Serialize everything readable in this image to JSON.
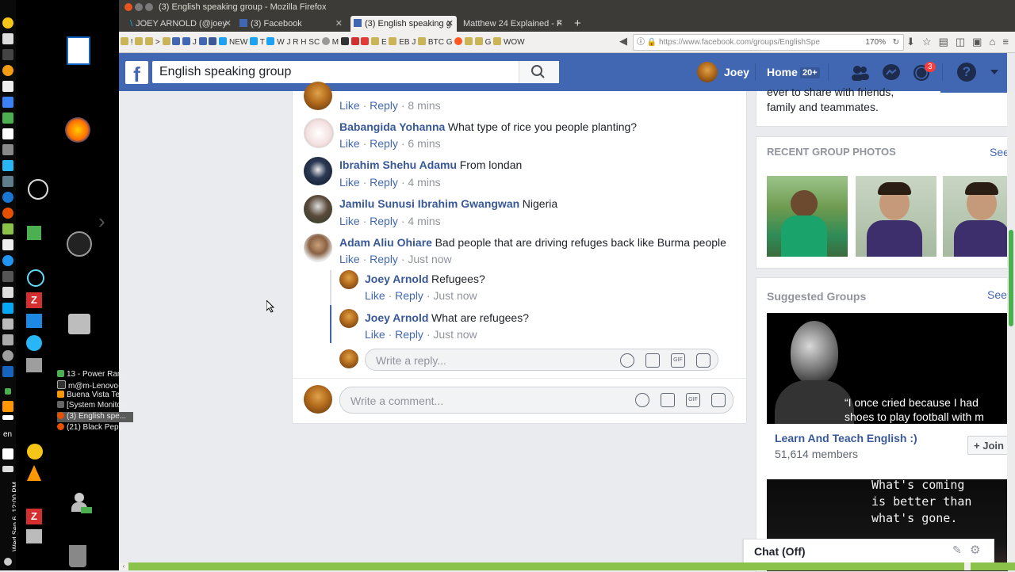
{
  "window": {
    "title": "(3) English speaking group - Mozilla Firefox"
  },
  "tabs": [
    {
      "label": "JOEY ARNOLD (@joey",
      "icon": "twitter-icon"
    },
    {
      "label": "(3) Facebook",
      "icon": "facebook-icon"
    },
    {
      "label": "(3) English speaking g",
      "icon": "facebook-icon",
      "active": true
    },
    {
      "label": "Matthew 24 Explained - F",
      "icon": ""
    }
  ],
  "bookmarks": [
    "!",
    ">",
    "J",
    "NEW",
    "T",
    "W",
    "J",
    "R",
    "H",
    "SC",
    "M",
    "E",
    "EB",
    "J",
    "BTC",
    "G",
    "G",
    "WOW"
  ],
  "address": {
    "url": "https://www.facebook.com/groups/EnglishSpe",
    "zoom": "170%"
  },
  "header": {
    "search_value": "English speaking group",
    "user_name": "Joey",
    "home_label": "Home",
    "home_badge": "20+",
    "notif_badge": "3",
    "brand_color": "#4267b2"
  },
  "comments": [
    {
      "name": "",
      "text": "",
      "like": "Like",
      "reply": "Reply",
      "time": "8 mins"
    },
    {
      "name": "Babangida Yohanna",
      "text": "What type of rice you people planting?",
      "like": "Like",
      "reply": "Reply",
      "time": "6 mins"
    },
    {
      "name": "Ibrahim Shehu Adamu",
      "text": "From londan",
      "like": "Like",
      "reply": "Reply",
      "time": "4 mins"
    },
    {
      "name": "Jamilu Sunusi Ibrahim Gwangwan",
      "text": "Nigeria",
      "like": "Like",
      "reply": "Reply",
      "time": "4 mins"
    },
    {
      "name": "Adam Aliu Ohiare",
      "text": "Bad people that are driving refuges back like Burma people",
      "like": "Like",
      "reply": "Reply",
      "time": "Just now"
    }
  ],
  "replies": [
    {
      "name": "Joey Arnold",
      "text": "Refugees?",
      "like": "Like",
      "reply": "Reply",
      "time": "Just now"
    },
    {
      "name": "Joey Arnold",
      "text": "What are refugees?",
      "like": "Like",
      "reply": "Reply",
      "time": "Just now"
    }
  ],
  "reply_placeholder": "Write a reply...",
  "comment_placeholder": "Write a comment...",
  "sidebar": {
    "top_text_line1": "ever to share with friends,",
    "top_text_line2": "family and teammates.",
    "photos_title": "RECENT GROUP PHOTOS",
    "see_all": "See",
    "suggested_title": "Suggested Groups",
    "suggested_see": "See",
    "quote_text_1": "“I once cried because I had",
    "quote_text_2": "shoes to play football with m",
    "group_name": "Learn And Teach English :)",
    "group_members": "51,614 members",
    "join_label": "Join",
    "quote2_line1": "What's coming",
    "quote2_line2": "is better than",
    "quote2_line3": "what's gone."
  },
  "chat": {
    "label": "Chat (Off)"
  },
  "taskbar": [
    {
      "label": "13 - Power Ran..."
    },
    {
      "label": "m@m-Lenovo-..."
    },
    {
      "label": "Buena Vista Te..."
    },
    {
      "label": "[System Monitor]"
    },
    {
      "label": "(3) English spe...",
      "active": true
    },
    {
      "label": "(21) Black Pep..."
    }
  ],
  "system": {
    "clock": "Wed Sep 6, 12:00 PM",
    "lang": "en"
  }
}
